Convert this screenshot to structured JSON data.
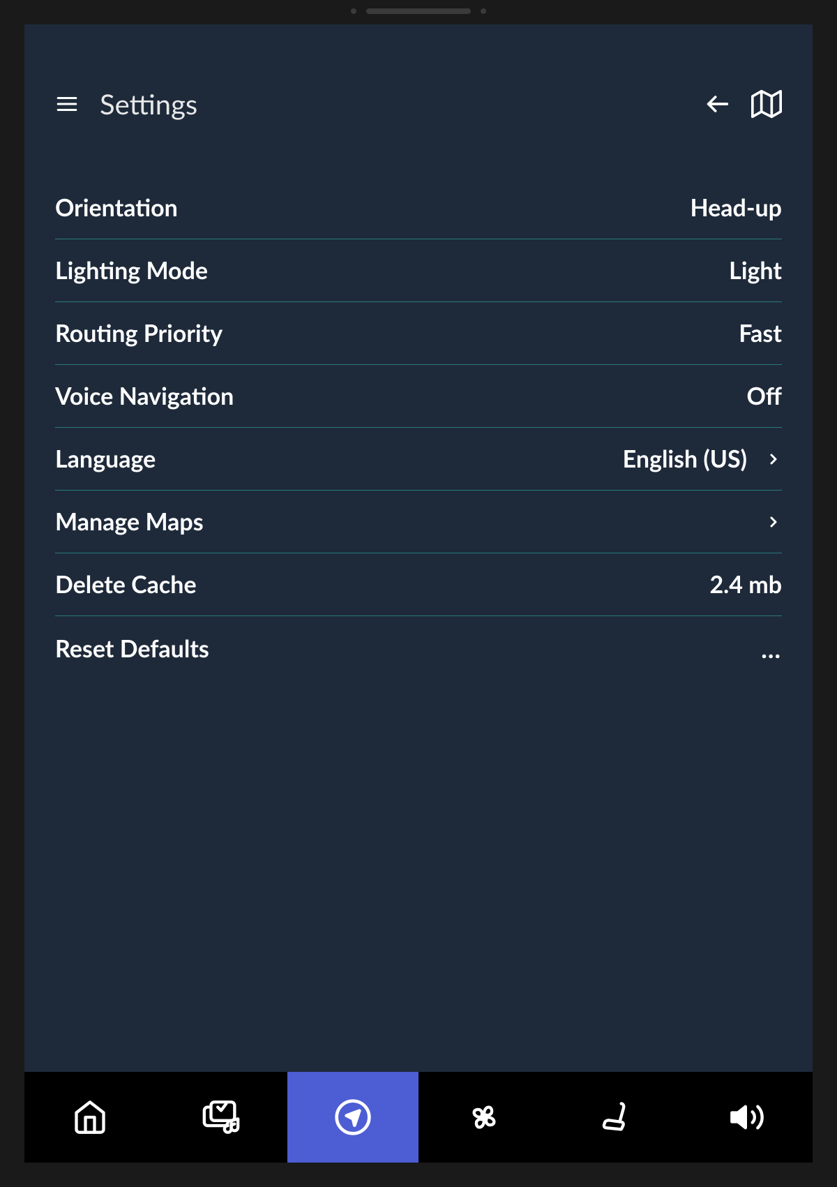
{
  "header": {
    "title": "Settings"
  },
  "settings": {
    "orientation": {
      "label": "Orientation",
      "value": "Head-up"
    },
    "lighting": {
      "label": "Lighting Mode",
      "value": "Light"
    },
    "routing": {
      "label": "Routing Priority",
      "value": "Fast"
    },
    "voice": {
      "label": "Voice Navigation",
      "value": "Off"
    },
    "language": {
      "label": "Language",
      "value": "English (US)"
    },
    "maps": {
      "label": "Manage Maps"
    },
    "cache": {
      "label": "Delete Cache",
      "value": "2.4 mb"
    },
    "reset": {
      "label": "Reset Defaults"
    }
  },
  "nav": {
    "items": [
      "home",
      "media",
      "navigation",
      "climate",
      "seat",
      "volume"
    ],
    "active": "navigation"
  }
}
